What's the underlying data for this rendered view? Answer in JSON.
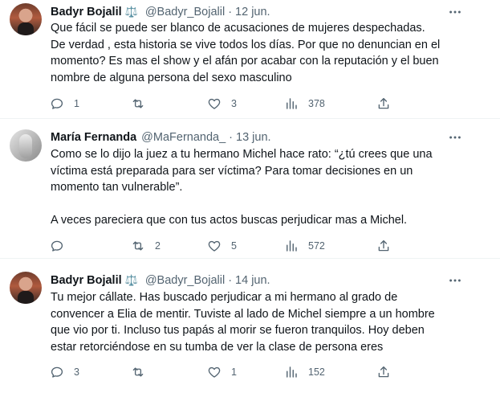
{
  "tweets": [
    {
      "name": "Badyr Bojalil",
      "badge": "⚖️",
      "handle": "@Badyr_Bojalil",
      "separator": "·",
      "date": "12 jun.",
      "lines": [
        "Que fácil se puede ser blanco de acusaciones de mujeres despechadas.",
        "De verdad , esta historia se vive todos los días. Por que no denuncian en el",
        "momento? Es mas el show y el afán por acabar con la reputación y el buen",
        "nombre de alguna persona del sexo masculino"
      ],
      "replies": "1",
      "retweets": "",
      "likes": "3",
      "views": "378"
    },
    {
      "name": "María Fernanda",
      "handle": "@MaFernanda_",
      "separator": "·",
      "date": "13 jun.",
      "lines": [
        "Como se lo dijo la juez a tu hermano Michel hace rato: “¿tú crees que una",
        "víctima está preparada para ser víctima? Para tomar decisiones en un",
        "momento tan vulnerable”.",
        "",
        "A veces pareciera que con tus actos buscas perjudicar  mas a Michel."
      ],
      "replies": "",
      "retweets": "2",
      "likes": "5",
      "views": "572"
    },
    {
      "name": "Badyr Bojalil",
      "badge": "⚖️",
      "handle": "@Badyr_Bojalil",
      "separator": "·",
      "date": "14 jun.",
      "lines": [
        "Tu mejor cállate. Has buscado perjudicar a mi hermano al grado de",
        "convencer a Elia de mentir. Tuviste al lado de Michel siempre a un hombre",
        "que vio por ti. Incluso tus papás al morir se fueron tranquilos. Hoy deben",
        "estar retorciéndose en su tumba de ver la clase de persona eres"
      ],
      "replies": "3",
      "retweets": "",
      "likes": "1",
      "views": "152"
    }
  ]
}
